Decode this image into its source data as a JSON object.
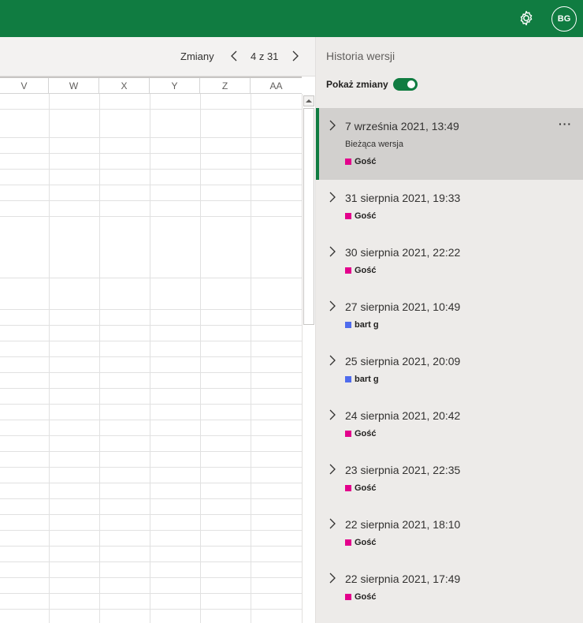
{
  "header": {
    "settings_icon": "gear-icon",
    "avatar_initials": "BG",
    "brand_color": "#107c41"
  },
  "changes_bar": {
    "label": "Zmiany",
    "counter": "4 z 31"
  },
  "columns": [
    "V",
    "W",
    "X",
    "Y",
    "Z",
    "AA"
  ],
  "panel": {
    "title": "Historia wersji",
    "toggle_label": "Pokaż zmiany",
    "toggle_on": true,
    "more_label": "···",
    "versions": [
      {
        "date": "7 września 2021, 13:49",
        "subtitle": "Bieżąca wersja",
        "author": "Gość",
        "author_color": "#e3008c",
        "current": true
      },
      {
        "date": "31 sierpnia 2021, 19:33",
        "author": "Gość",
        "author_color": "#e3008c"
      },
      {
        "date": "30 sierpnia 2021, 22:22",
        "author": "Gość",
        "author_color": "#e3008c"
      },
      {
        "date": "27 sierpnia 2021, 10:49",
        "author": "bart g",
        "author_color": "#4f6bed"
      },
      {
        "date": "25 sierpnia 2021, 20:09",
        "author": "bart g",
        "author_color": "#4f6bed"
      },
      {
        "date": "24 sierpnia 2021, 20:42",
        "author": "Gość",
        "author_color": "#e3008c"
      },
      {
        "date": "23 sierpnia 2021, 22:35",
        "author": "Gość",
        "author_color": "#e3008c"
      },
      {
        "date": "22 sierpnia 2021, 18:10",
        "author": "Gość",
        "author_color": "#e3008c"
      },
      {
        "date": "22 sierpnia 2021, 17:49",
        "author": "Gość",
        "author_color": "#e3008c"
      }
    ]
  }
}
